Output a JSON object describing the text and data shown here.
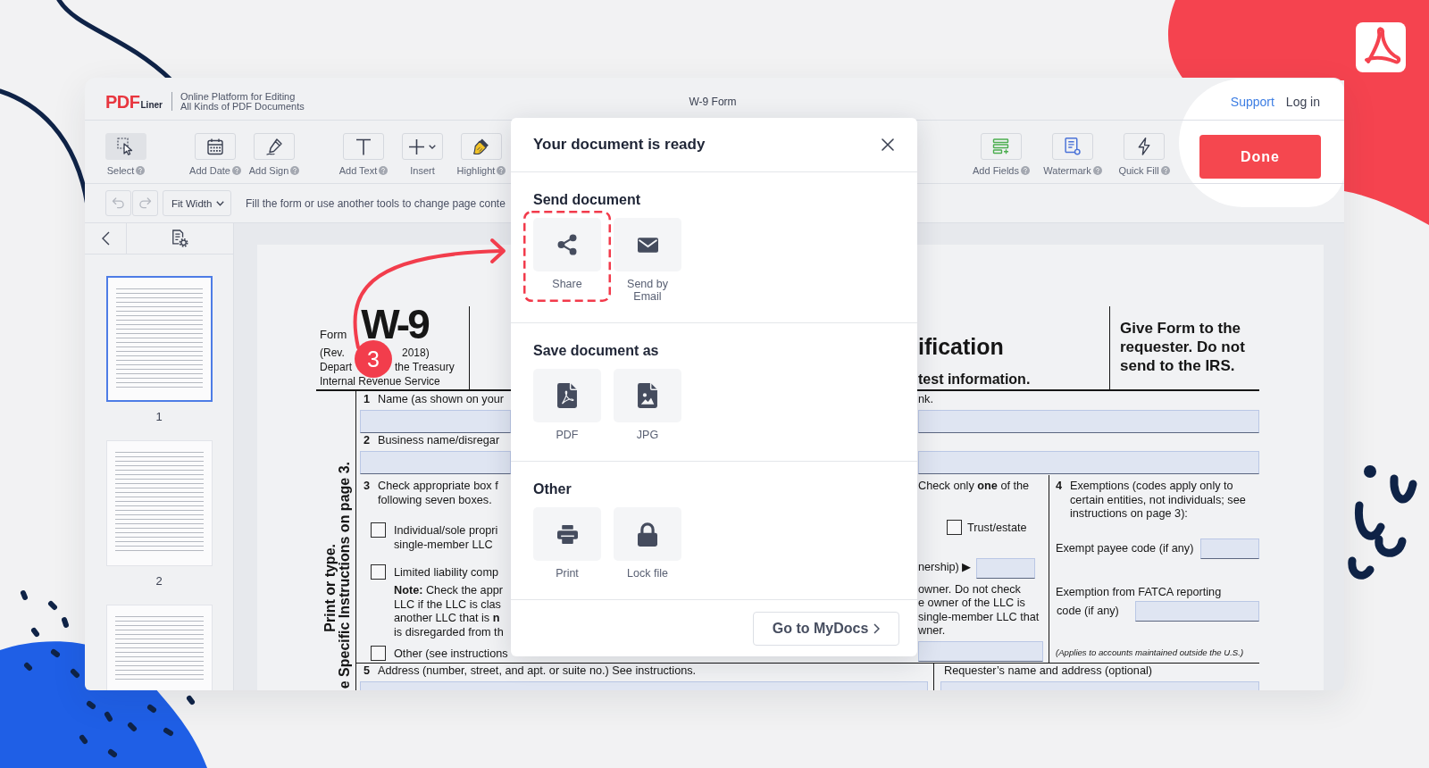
{
  "header": {
    "logo": {
      "main": "PDF",
      "sub": "Liner"
    },
    "tagline": [
      "Online Platform for Editing",
      "All Kinds of PDF Documents"
    ],
    "title": "W-9 Form",
    "links": [
      {
        "label": "Support",
        "kind": "link"
      },
      {
        "label": "Log in",
        "kind": "plain"
      }
    ]
  },
  "toolbar": {
    "groups": [
      {
        "tools": [
          {
            "label": "Select",
            "kind": "select",
            "help": true,
            "selected": true
          }
        ]
      },
      {
        "tools": [
          {
            "label": "Add Date",
            "kind": "date",
            "help": true,
            "selected": false
          },
          {
            "label": "Add Sign",
            "kind": "sign",
            "help": true,
            "selected": false
          }
        ]
      },
      {
        "tools": [
          {
            "label": "Add Text",
            "kind": "text",
            "help": true,
            "selected": false
          },
          {
            "label": "Insert",
            "kind": "insert",
            "help": false,
            "selected": false
          },
          {
            "label": "Highlight",
            "kind": "highlight",
            "help": true,
            "selected": false
          }
        ]
      }
    ],
    "right_group": {
      "tools": [
        {
          "label": "Add Fields",
          "kind": "fields",
          "help": true,
          "selected": false
        },
        {
          "label": "Watermark",
          "kind": "watermark",
          "help": true,
          "selected": false
        },
        {
          "label": "Quick Fill",
          "kind": "quickfill",
          "help": true,
          "selected": false
        }
      ]
    },
    "done_button": "Done"
  },
  "subbar": {
    "history": [
      {
        "kind": "undo",
        "disabled": true
      },
      {
        "kind": "redo",
        "disabled": true
      }
    ],
    "zoom": "Fit Width",
    "hint": "Fill the form or use another tools to change page conte"
  },
  "sidebar": {
    "pages": [
      {
        "number": "1",
        "selected": true
      },
      {
        "number": "2",
        "selected": false
      },
      {
        "selected": false
      }
    ]
  },
  "document": {
    "form_header": {
      "form_label": "Form",
      "form_number": "W-9",
      "revision": [
        "(Rev.",
        "2018)"
      ],
      "department": [
        "Depart",
        "the Treasury"
      ],
      "agency": "Internal Revenue Service",
      "title": "ification",
      "subtitle": "test information.",
      "notice": "Give Form to the requester. Do not send to the IRS."
    },
    "side_note": [
      "Print or type.",
      "e Specific Instructions on page 3."
    ],
    "line_1": {
      "number": "1",
      "label": "Name (as shown on your",
      "label_right": "nk."
    },
    "line_2": {
      "number": "2",
      "label": "Business name/disregar"
    },
    "line_3": {
      "number": "3",
      "label": [
        "Check appropriate box f",
        "following seven boxes."
      ],
      "label_right": "Check only **one** of the",
      "options": [
        {
          "lines": [
            "Individual/sole propri",
            "single-member LLC"
          ],
          "checked": false
        },
        {
          "lines": [
            "Limited liability comp"
          ],
          "checked": false
        }
      ],
      "note": [
        "**Note:** Check the appr",
        "LLC if the LLC is clas",
        "another LLC that is **n**",
        "is disregarded from th"
      ],
      "other": {
        "label": "Other (see instructions",
        "checked": false
      },
      "trust": {
        "label": "Trust/estate",
        "checked": false
      },
      "partnership": "nership) ▶",
      "note_right": [
        "owner. Do not check",
        "e owner of the LLC is",
        "single-member LLC that",
        "wner."
      ]
    },
    "line_4": {
      "number": "4",
      "label": [
        "Exemptions (codes apply only to",
        "certain entities, not individuals; see",
        "instructions on page 3):"
      ],
      "payee": "Exempt payee code (if any)",
      "fatca": [
        "Exemption from FATCA reporting",
        "code (if any)"
      ],
      "footnote": "(Applies to accounts maintained outside the U.S.)"
    },
    "line_5": {
      "number": "5",
      "label": "Address (number, street, and apt. or suite no.) See instructions.",
      "label_right": "Requester’s name and address (optional)"
    }
  },
  "dialog": {
    "title": "Your document is ready",
    "sections": [
      {
        "title": "Send document",
        "actions": [
          {
            "label": "Share",
            "kind": "share",
            "highlighted": true
          },
          {
            "label": "Send by Email",
            "kind": "email",
            "highlighted": false
          }
        ]
      },
      {
        "title": "Save document as",
        "actions": [
          {
            "label": "PDF",
            "kind": "pdf",
            "highlighted": false
          },
          {
            "label": "JPG",
            "kind": "jpg",
            "highlighted": false
          }
        ]
      },
      {
        "title": "Other",
        "actions": [
          {
            "label": "Print",
            "kind": "print",
            "highlighted": false
          },
          {
            "label": "Lock file",
            "kind": "lock",
            "highlighted": false
          }
        ]
      }
    ],
    "footer_button": "Go to MyDocs"
  },
  "callout": {
    "step": "3"
  }
}
